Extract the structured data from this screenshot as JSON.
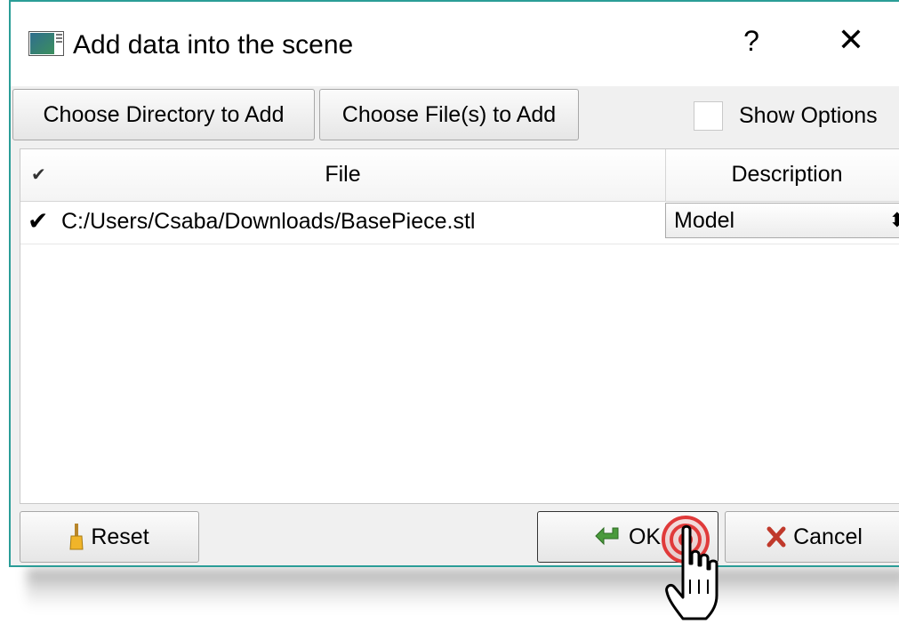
{
  "dialog": {
    "title": "Add data into the scene",
    "help_label": "?",
    "close_label": "✕"
  },
  "toolbar": {
    "choose_directory_label": "Choose Directory to Add",
    "choose_files_label": "Choose File(s) to Add",
    "show_options_label": "Show Options",
    "show_options_checked": false
  },
  "table": {
    "columns": [
      "File",
      "Description"
    ],
    "header_check": "✔",
    "rows": [
      {
        "checked": "✔",
        "file": "C:/Users/Csaba/Downloads/BasePiece.stl",
        "description": "Model",
        "description_arrows": "⬍"
      }
    ]
  },
  "footer": {
    "reset_label": "Reset",
    "ok_label": "OK",
    "cancel_label": "Cancel"
  },
  "icons": {
    "app": "app-window-icon",
    "reset": "broom-icon",
    "ok": "green-arrow-icon",
    "cancel": "red-x-icon"
  },
  "colors": {
    "border_accent": "#2a9d97",
    "click_ring": "#e03a3a"
  }
}
